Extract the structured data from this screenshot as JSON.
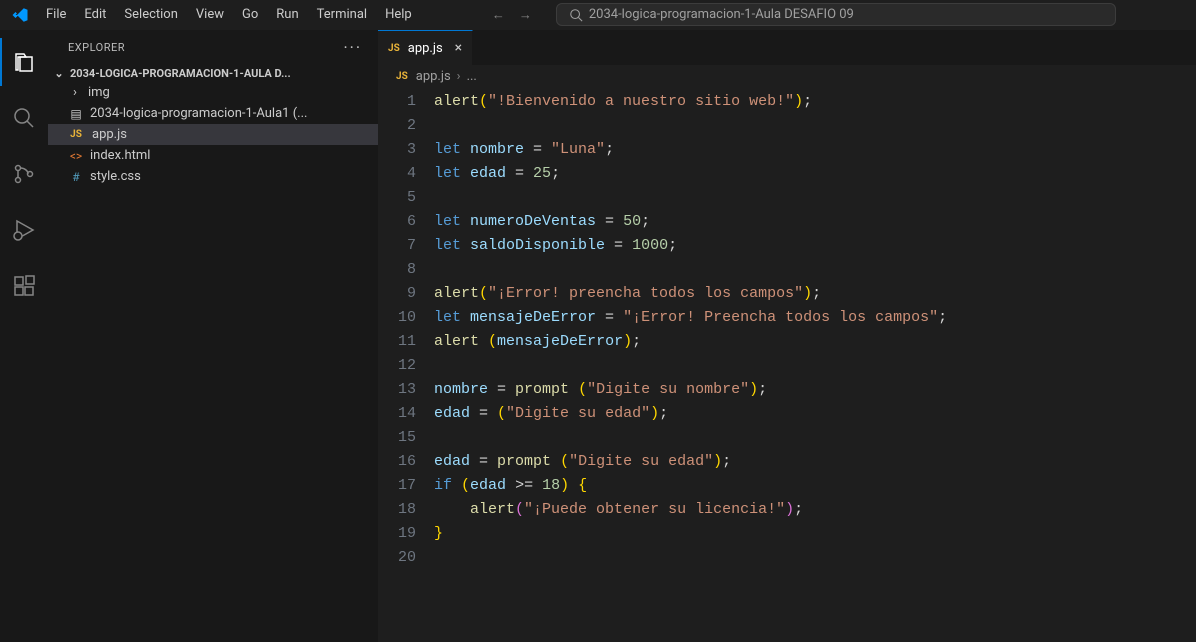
{
  "titlebar": {
    "menu": [
      "File",
      "Edit",
      "Selection",
      "View",
      "Go",
      "Run",
      "Terminal",
      "Help"
    ],
    "search_text": "2034-logica-programacion-1-Aula DESAFIO 09"
  },
  "sidebar": {
    "title": "EXPLORER",
    "folder_name": "2034-LOGICA-PROGRAMACION-1-AULA D...",
    "items": [
      {
        "type": "folder",
        "name": "img",
        "expanded": false
      },
      {
        "type": "file",
        "name": "2034-logica-programacion-1-Aula1 (...",
        "icon": "generic"
      },
      {
        "type": "file",
        "name": "app.js",
        "icon": "js",
        "active": true
      },
      {
        "type": "file",
        "name": "index.html",
        "icon": "html"
      },
      {
        "type": "file",
        "name": "style.css",
        "icon": "css"
      }
    ]
  },
  "tabs": [
    {
      "label": "app.js",
      "icon": "js",
      "active": true
    }
  ],
  "breadcrumb": {
    "file_icon": "js",
    "file": "app.js",
    "more": "..."
  },
  "code": {
    "lines": [
      {
        "n": 1,
        "tokens": [
          [
            "fn",
            "alert"
          ],
          [
            "par",
            "("
          ],
          [
            "str",
            "\"!Bienvenido a nuestro sitio web!\""
          ],
          [
            "par",
            ")"
          ],
          [
            "punc",
            ";"
          ]
        ]
      },
      {
        "n": 2,
        "tokens": []
      },
      {
        "n": 3,
        "tokens": [
          [
            "kw",
            "let "
          ],
          [
            "var",
            "nombre"
          ],
          [
            "punc",
            " = "
          ],
          [
            "str",
            "\"Luna\""
          ],
          [
            "punc",
            ";"
          ]
        ]
      },
      {
        "n": 4,
        "tokens": [
          [
            "kw",
            "let "
          ],
          [
            "var",
            "edad"
          ],
          [
            "punc",
            " = "
          ],
          [
            "num",
            "25"
          ],
          [
            "punc",
            ";"
          ]
        ]
      },
      {
        "n": 5,
        "tokens": []
      },
      {
        "n": 6,
        "tokens": [
          [
            "kw",
            "let "
          ],
          [
            "var",
            "numeroDeVentas"
          ],
          [
            "punc",
            " = "
          ],
          [
            "num",
            "50"
          ],
          [
            "punc",
            ";"
          ]
        ]
      },
      {
        "n": 7,
        "tokens": [
          [
            "kw",
            "let "
          ],
          [
            "var",
            "saldoDisponible"
          ],
          [
            "punc",
            " = "
          ],
          [
            "num",
            "1000"
          ],
          [
            "punc",
            ";"
          ]
        ]
      },
      {
        "n": 8,
        "tokens": []
      },
      {
        "n": 9,
        "tokens": [
          [
            "fn",
            "alert"
          ],
          [
            "par",
            "("
          ],
          [
            "str",
            "\"¡Error! preencha todos los campos\""
          ],
          [
            "par",
            ")"
          ],
          [
            "punc",
            ";"
          ]
        ]
      },
      {
        "n": 10,
        "tokens": [
          [
            "kw",
            "let "
          ],
          [
            "var",
            "mensajeDeError"
          ],
          [
            "punc",
            " = "
          ],
          [
            "str",
            "\"¡Error! Preencha todos los campos\""
          ],
          [
            "punc",
            ";"
          ]
        ]
      },
      {
        "n": 11,
        "tokens": [
          [
            "fn",
            "alert"
          ],
          [
            "punc",
            " "
          ],
          [
            "par",
            "("
          ],
          [
            "var",
            "mensajeDeError"
          ],
          [
            "par",
            ")"
          ],
          [
            "punc",
            ";"
          ]
        ]
      },
      {
        "n": 12,
        "tokens": []
      },
      {
        "n": 13,
        "tokens": [
          [
            "var",
            "nombre"
          ],
          [
            "punc",
            " = "
          ],
          [
            "fn",
            "prompt"
          ],
          [
            "punc",
            " "
          ],
          [
            "par",
            "("
          ],
          [
            "str",
            "\"Digite su nombre\""
          ],
          [
            "par",
            ")"
          ],
          [
            "punc",
            ";"
          ]
        ]
      },
      {
        "n": 14,
        "tokens": [
          [
            "var",
            "edad"
          ],
          [
            "punc",
            " = "
          ],
          [
            "par",
            "("
          ],
          [
            "str",
            "\"Digite su edad\""
          ],
          [
            "par",
            ")"
          ],
          [
            "punc",
            ";"
          ]
        ]
      },
      {
        "n": 15,
        "tokens": []
      },
      {
        "n": 16,
        "tokens": [
          [
            "var",
            "edad"
          ],
          [
            "punc",
            " = "
          ],
          [
            "fn",
            "prompt"
          ],
          [
            "punc",
            " "
          ],
          [
            "par",
            "("
          ],
          [
            "str",
            "\"Digite su edad\""
          ],
          [
            "par",
            ")"
          ],
          [
            "punc",
            ";"
          ]
        ]
      },
      {
        "n": 17,
        "tokens": [
          [
            "kw",
            "if"
          ],
          [
            "punc",
            " "
          ],
          [
            "par",
            "("
          ],
          [
            "var",
            "edad"
          ],
          [
            "punc",
            " >= "
          ],
          [
            "num",
            "18"
          ],
          [
            "par",
            ")"
          ],
          [
            "punc",
            " "
          ],
          [
            "par",
            "{"
          ]
        ]
      },
      {
        "n": 18,
        "tokens": [
          [
            "punc",
            "    "
          ],
          [
            "fn",
            "alert"
          ],
          [
            "par2",
            "("
          ],
          [
            "str",
            "\"¡Puede obtener su licencia!\""
          ],
          [
            "par2",
            ")"
          ],
          [
            "punc",
            ";"
          ]
        ]
      },
      {
        "n": 19,
        "tokens": [
          [
            "par",
            "}"
          ]
        ]
      },
      {
        "n": 20,
        "tokens": []
      }
    ]
  }
}
